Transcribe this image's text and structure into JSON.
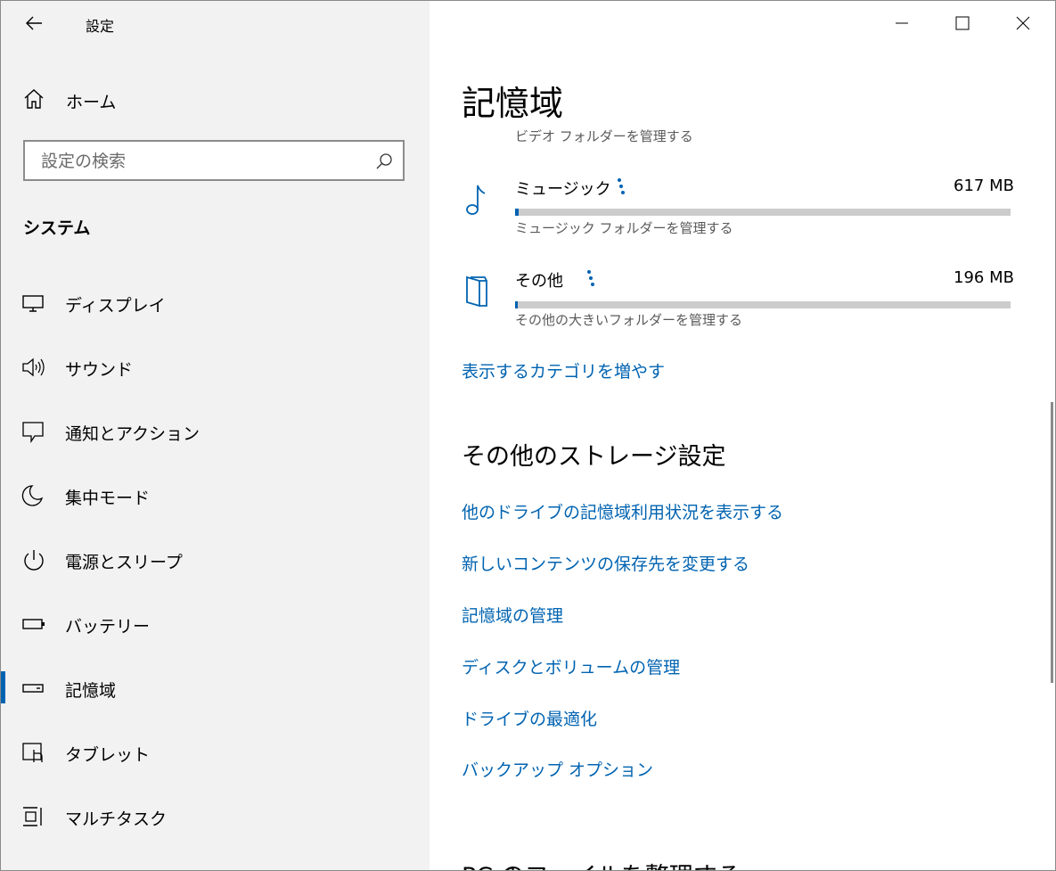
{
  "window": {
    "title": "設定"
  },
  "sidebar": {
    "home": "ホーム",
    "search_placeholder": "設定の検索",
    "section": "システム",
    "items": [
      {
        "label": "ディスプレイ",
        "icon": "monitor-icon"
      },
      {
        "label": "サウンド",
        "icon": "speaker-icon"
      },
      {
        "label": "通知とアクション",
        "icon": "notification-icon"
      },
      {
        "label": "集中モード",
        "icon": "moon-icon"
      },
      {
        "label": "電源とスリープ",
        "icon": "power-icon"
      },
      {
        "label": "バッテリー",
        "icon": "battery-icon"
      },
      {
        "label": "記憶域",
        "icon": "storage-drive-icon",
        "active": true
      },
      {
        "label": "タブレット",
        "icon": "tablet-icon"
      },
      {
        "label": "マルチタスク",
        "icon": "multitask-icon"
      }
    ]
  },
  "main": {
    "title": "記憶域",
    "video_manage": "ビデオ フォルダーを管理する",
    "categories": [
      {
        "name": "ミュージック",
        "size": "617 MB",
        "desc": "ミュージック フォルダーを管理する",
        "icon": "music-note-icon",
        "usage_fraction": 0.007
      },
      {
        "name": "その他",
        "size": "196 MB",
        "desc": "その他の大きいフォルダーを管理する",
        "icon": "folder-icon",
        "usage_fraction": 0.003
      }
    ],
    "show_more_link": "表示するカテゴリを増やす",
    "more_settings_heading": "その他のストレージ設定",
    "links": [
      "他のドライブの記憶域利用状況を表示する",
      "新しいコンテンツの保存先を変更する",
      "記憶域の管理",
      "ディスクとボリュームの管理",
      "ドライブの最適化",
      "バックアップ オプション"
    ],
    "cutoff_heading": "PC のファイルを整理する"
  },
  "colors": {
    "accent": "#0063b1",
    "sidebar_bg": "#f2f2f2",
    "bar_track": "#cccccc"
  }
}
